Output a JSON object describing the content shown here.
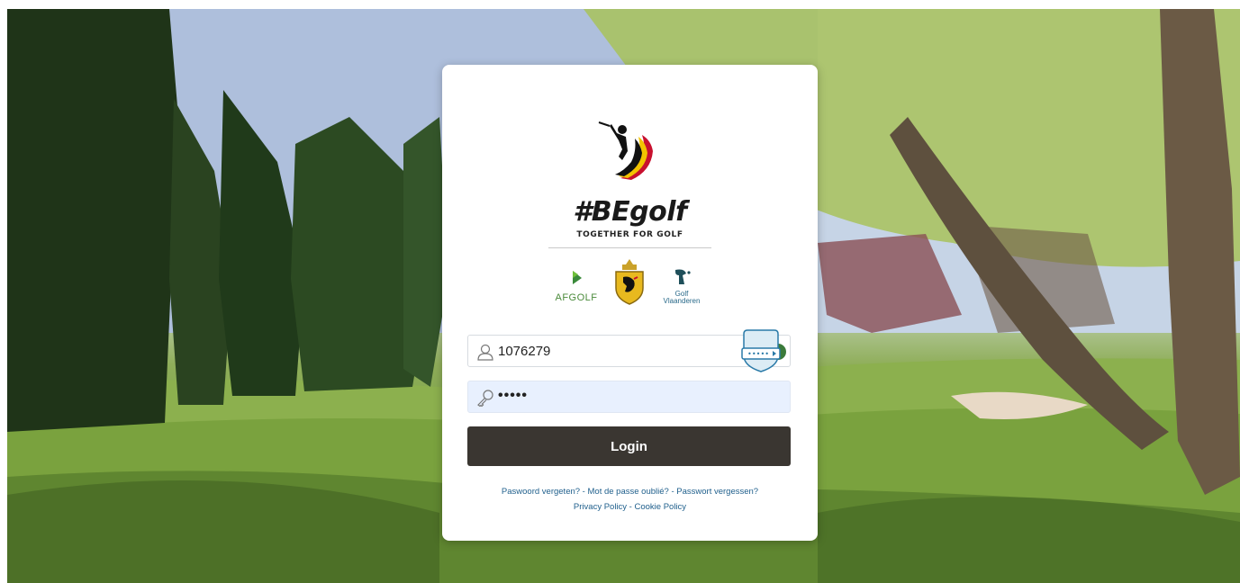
{
  "brand": {
    "title": "#BEgolf",
    "tagline": "TOGETHER FOR GOLF",
    "federations": [
      {
        "name": "AFGOLF",
        "icon": "afgolf-logo"
      },
      {
        "name": "Royal Belgian Golf Federation",
        "icon": "belgian-crest-logo"
      },
      {
        "name_line1": "Golf",
        "name_line2": "Vlaanderen",
        "icon": "golf-vlaanderen-logo"
      }
    ]
  },
  "form": {
    "username_value": "1076279",
    "username_icon": "user-icon",
    "password_value": "•••••",
    "password_icon": "key-icon",
    "password_manager_icon": "password-manager-icon",
    "login_label": "Login"
  },
  "links": {
    "forgot_nl": "Paswoord vergeten?",
    "forgot_fr": "Mot de passe oublié?",
    "forgot_de": "Passwort vergessen?",
    "separator": " - ",
    "privacy": "Privacy Policy",
    "cookie": "Cookie Policy"
  },
  "colors": {
    "button_bg": "#3a3631",
    "link": "#1f5f8c",
    "password_field_bg": "#e8f0fe"
  }
}
